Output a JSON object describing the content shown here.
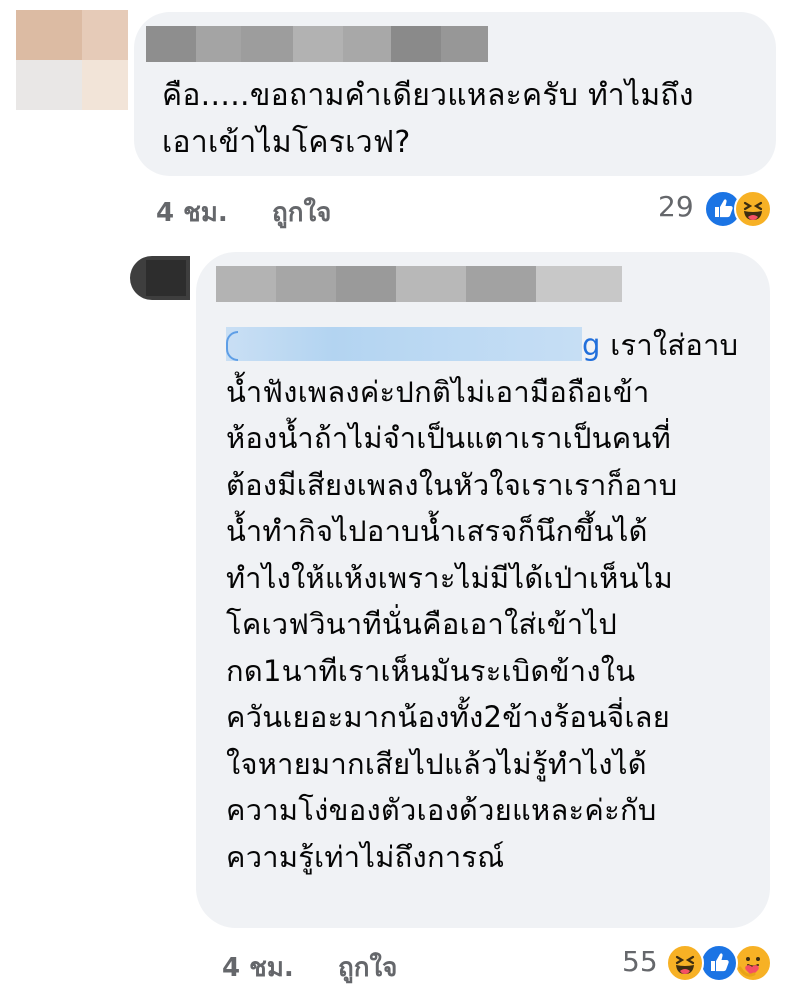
{
  "comment1": {
    "text": "คือ.....ขอถามคำเดียวแหละครับ ทำไมถึง\nเอาเข้าไมโครเวฟ?",
    "time": "4 ชม.",
    "like_label": "ถูกใจ",
    "reaction_count": "29",
    "reactions": [
      "like-icon",
      "haha-icon"
    ]
  },
  "comment2": {
    "mention_end": "g",
    "text": "เราใส่อาบ\nน้ำฟังเพลงค่ะปกติไม่เอามือถือเข้า\nห้องน้ำถ้าไม่จำเป็นแตาเราเป็นคนที่\nต้องมีเสียงเพลงในหัวใจเราเราก็อาบ\nน้ำทำกิจไปอาบน้ำเสรจก็นึกขึ้นได้\nทำไงให้แห้งเพราะไม่มีได้เป่าเห็นไม\nโคเวฟวินาทีนั่นคือเอาใส่เข้าไป\nกด1นาทีเราเห็นมันระเบิดข้างใน\nควันเยอะมากน้องทั้ง2ข้างร้อนจี่เลย\nใจหายมากเสียไปแล้วไม่รู้ทำไงได้\nความโง่ของตัวเองด้วยแหละค่ะกับ\nความรู้เท่าไม่ถึงการณ์",
    "time": "4 ชม.",
    "like_label": "ถูกใจ",
    "reaction_count": "55",
    "reactions": [
      "haha-icon",
      "like-icon",
      "care-icon"
    ]
  },
  "colors": {
    "bubble": "#f0f2f5",
    "meta": "#65676b",
    "mention": "#216fdb",
    "like": "#1b74e4",
    "haha": "#f7b125"
  }
}
